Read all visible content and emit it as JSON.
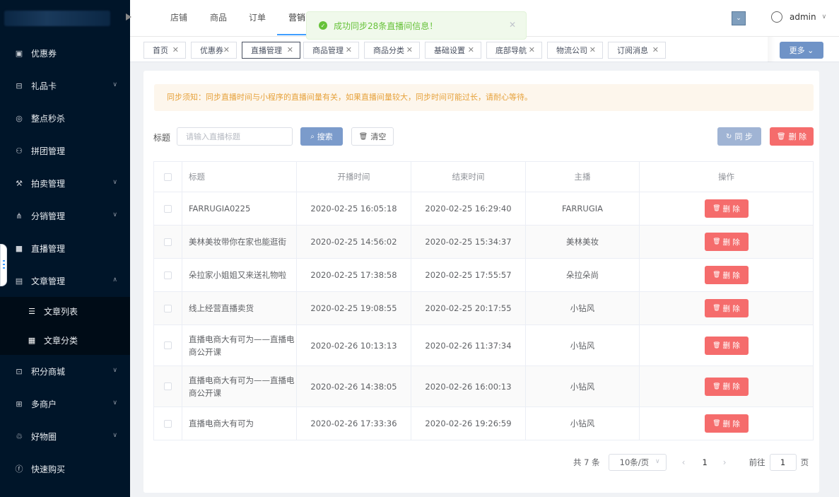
{
  "sidebar": {
    "items": [
      {
        "label": "优惠券",
        "icon": "coupon-icon",
        "glyph": "▣",
        "arrow": false
      },
      {
        "label": "礼品卡",
        "icon": "gift-card-icon",
        "glyph": "⊟",
        "arrow": true
      },
      {
        "label": "整点秒杀",
        "icon": "flash-sale-icon",
        "glyph": "◎",
        "arrow": false
      },
      {
        "label": "拼团管理",
        "icon": "group-buy-icon",
        "glyph": "⚇",
        "arrow": false
      },
      {
        "label": "拍卖管理",
        "icon": "auction-icon",
        "glyph": "⚒",
        "arrow": true
      },
      {
        "label": "分销管理",
        "icon": "distribution-icon",
        "glyph": "⋔",
        "arrow": true
      },
      {
        "label": "直播管理",
        "icon": "live-video-icon",
        "glyph": "■",
        "arrow": false
      },
      {
        "label": "文章管理",
        "icon": "article-icon",
        "glyph": "▤",
        "arrow": true,
        "expanded": true
      },
      {
        "label": "文章列表",
        "icon": "list-icon",
        "glyph": "☰",
        "sub": true
      },
      {
        "label": "文章分类",
        "icon": "category-icon",
        "glyph": "▦",
        "sub": true
      },
      {
        "label": "积分商城",
        "icon": "points-mall-icon",
        "glyph": "⊡",
        "arrow": true
      },
      {
        "label": "多商户",
        "icon": "merchant-icon",
        "glyph": "⊞",
        "arrow": true
      },
      {
        "label": "好物圈",
        "icon": "good-circle-icon",
        "glyph": "♲",
        "arrow": true
      },
      {
        "label": "快速购买",
        "icon": "quick-buy-icon",
        "glyph": "ⓕ",
        "arrow": false
      }
    ]
  },
  "topnav": {
    "tabs": [
      "店铺",
      "商品",
      "订单",
      "营销"
    ],
    "active_tab": "营销",
    "user": "admin"
  },
  "toast": {
    "message": "成功同步28条直播间信息！"
  },
  "tags": {
    "items": [
      "首页",
      "优惠券",
      "直播管理",
      "商品管理",
      "商品分类",
      "基础设置",
      "底部导航",
      "物流公司",
      "订阅消息"
    ],
    "active": "直播管理",
    "more_label": "更多"
  },
  "notice": "同步须知：同步直播时间与小程序的直播间量有关，如果直播间量较大，同步时间可能过长，请耐心等待。",
  "search": {
    "label": "标题",
    "placeholder": "请输入直播标题",
    "search_label": "搜索",
    "clear_label": "清空",
    "sync_label": "同 步",
    "delete_label": "删 除"
  },
  "table": {
    "headers": [
      "标题",
      "开播时间",
      "结束时间",
      "主播",
      "操作"
    ],
    "delete_label": "删 除",
    "rows": [
      {
        "title": "FARRUGIA0225",
        "start": "2020-02-25 16:05:18",
        "end": "2020-02-25 16:29:40",
        "anchor": "FARRUGIA"
      },
      {
        "title": "美林美妆带你在家也能逛街",
        "start": "2020-02-25 14:56:02",
        "end": "2020-02-25 15:34:37",
        "anchor": "美林美妆"
      },
      {
        "title": "朵拉家小姐姐又来送礼物啦",
        "start": "2020-02-25 17:38:58",
        "end": "2020-02-25 17:55:57",
        "anchor": "朵拉朵尚"
      },
      {
        "title": "线上经营直播卖货",
        "start": "2020-02-25 19:08:55",
        "end": "2020-02-25 20:17:55",
        "anchor": "小钻风"
      },
      {
        "title": "直播电商大有可为——直播电商公开课",
        "start": "2020-02-26 10:13:13",
        "end": "2020-02-26 11:37:34",
        "anchor": "小钻风"
      },
      {
        "title": "直播电商大有可为——直播电商公开课",
        "start": "2020-02-26 14:38:05",
        "end": "2020-02-26 16:00:13",
        "anchor": "小钻风"
      },
      {
        "title": "直播电商大有可为",
        "start": "2020-02-26 17:33:36",
        "end": "2020-02-26 19:26:59",
        "anchor": "小钻风"
      }
    ]
  },
  "pagination": {
    "total": "共 7 条",
    "page_size": "10条/页",
    "current": "1",
    "goto_prefix": "前往",
    "goto_value": "1",
    "goto_suffix": "页"
  },
  "colors": {
    "sidebar_bg": "#001529",
    "primary": "#409eff",
    "danger": "#f56c6c",
    "success": "#67c23a",
    "warning": "#e6a23c"
  }
}
